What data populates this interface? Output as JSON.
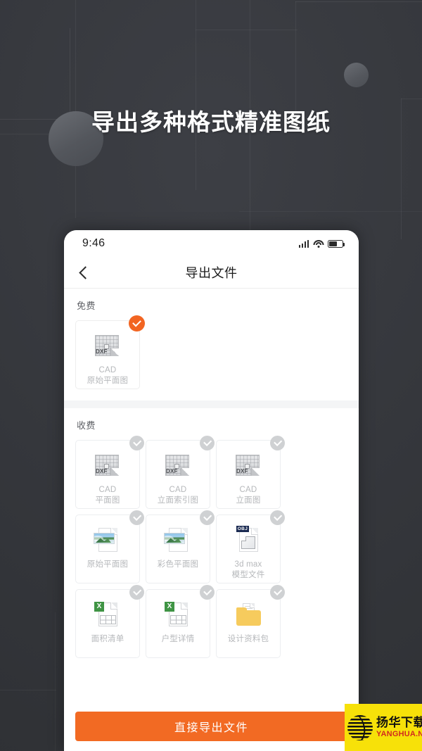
{
  "promo": {
    "headline": "导出多种格式精准图纸",
    "background_color": "#36383d"
  },
  "phone": {
    "statusbar": {
      "time": "9:46",
      "signal_icon": "signal-bars-icon",
      "wifi_icon": "wifi-icon",
      "battery_icon": "battery-icon"
    },
    "navbar": {
      "back_icon": "back-chevron-icon",
      "title": "导出文件"
    },
    "free_section": {
      "title": "免费",
      "items": [
        {
          "label": "CAD\n原始平面图",
          "icon": "dxf-file-icon",
          "icon_text": "DXF",
          "selected": true
        }
      ]
    },
    "paid_section": {
      "title": "收费",
      "items": [
        {
          "label": "CAD\n平面图",
          "icon": "dxf-file-icon",
          "icon_text": "DXF",
          "selected": false
        },
        {
          "label": "CAD\n立面索引图",
          "icon": "dxf-file-icon",
          "icon_text": "DXF",
          "selected": false
        },
        {
          "label": "CAD\n立面图",
          "icon": "dxf-file-icon",
          "icon_text": "DXF",
          "selected": false
        },
        {
          "label": "原始平面图",
          "icon": "image-file-icon",
          "icon_text": "",
          "selected": false
        },
        {
          "label": "彩色平面图",
          "icon": "image-file-icon",
          "icon_text": "",
          "selected": false
        },
        {
          "label": "3d max\n模型文件",
          "icon": "obj-file-icon",
          "icon_text": "OBJ",
          "selected": false
        },
        {
          "label": "面积清单",
          "icon": "excel-file-icon",
          "icon_text": "X",
          "selected": false
        },
        {
          "label": "户型详情",
          "icon": "excel-file-icon",
          "icon_text": "X",
          "selected": false
        },
        {
          "label": "设计资料包",
          "icon": "folder-icon",
          "icon_text": "",
          "selected": false
        }
      ]
    },
    "cta": {
      "label": "直接导出文件",
      "color": "#f26a23"
    }
  },
  "watermark": {
    "cn": "扬华下载",
    "en": "YANGHUA.NET",
    "bg_color": "#f7e109"
  }
}
